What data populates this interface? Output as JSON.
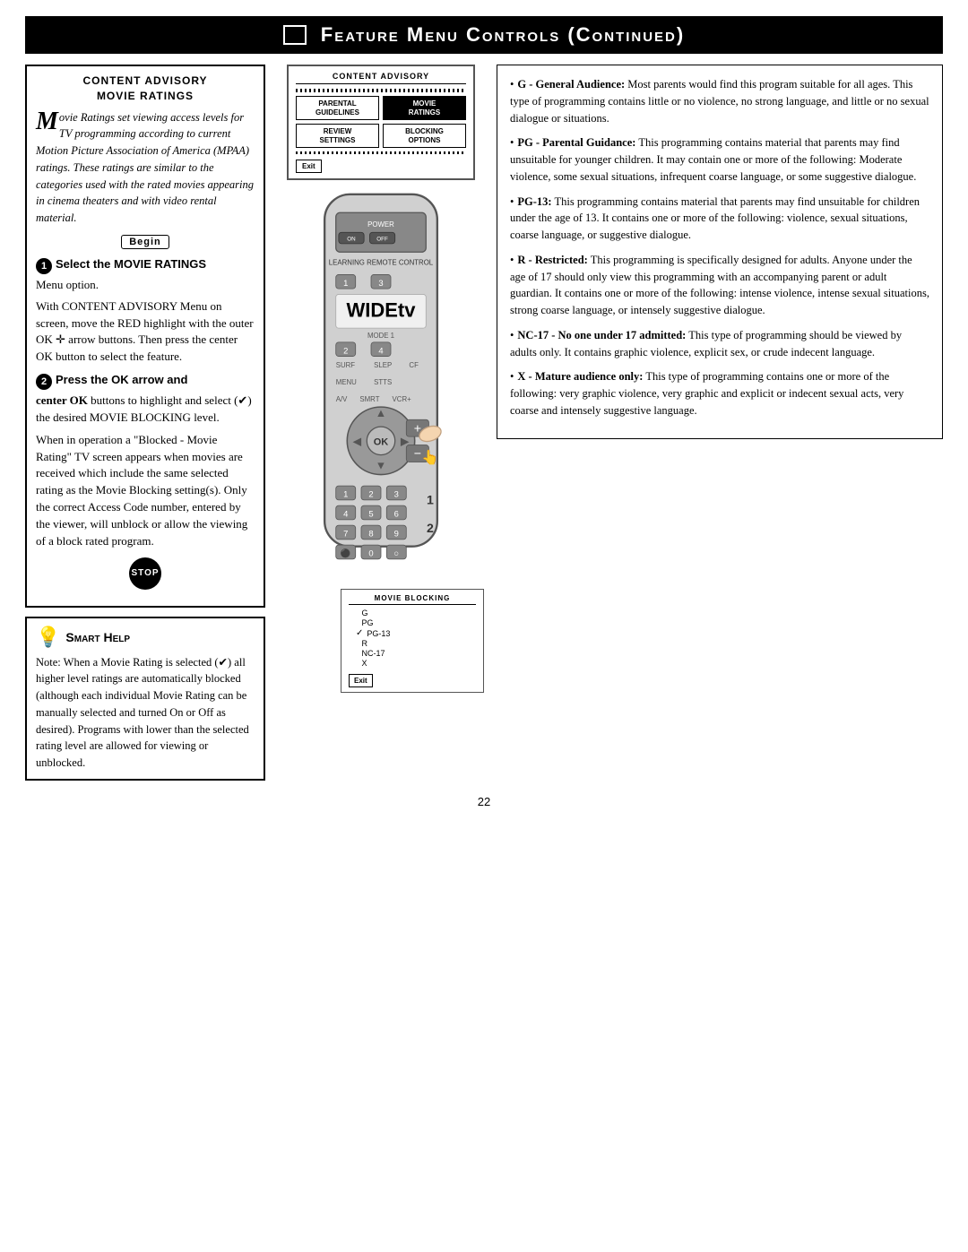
{
  "header": {
    "title": "Feature Menu Controls (Continued)",
    "corner_box": ""
  },
  "left_col": {
    "advisory_header_line1": "Content Advisory",
    "advisory_header_line2": "Movie Ratings",
    "drop_cap": "M",
    "advisory_body": "ovie Ratings set viewing access levels for TV programming according to current Motion Picture Association of America (MPAA) ratings. These ratings are similar to the categories used with the rated movies appearing in cinema theaters and with video rental material.",
    "begin_label": "Begin",
    "step1_title": "Select the MOVIE RATINGS",
    "step1_sub": "Menu option.",
    "step1_detail": "With CONTENT ADVISORY Menu on screen, move the RED highlight with the outer OK ✛ arrow buttons. Then press the center OK button to select the feature.",
    "step2_title": "Press the OK arrow and",
    "step2_detail_bold": "center OK",
    "step2_detail": " buttons to highlight and select (✔) the desired MOVIE BLOCKING level.",
    "step2_extra": "When in operation a \"Blocked - Movie Rating\" TV screen appears when movies are received which include the same selected rating as the Movie Blocking setting(s). Only the correct Access Code number, entered by the viewer, will unblock or allow the viewing of a block rated program.",
    "stop_label": "STOP",
    "smart_help_title": "Smart Help",
    "smart_help_body": "Note: When a Movie Rating is selected (✔) all higher level ratings are automatically blocked (although each individual Movie Rating can be manually selected and turned On or Off as desired). Programs with lower than the selected rating level are allowed for viewing or unblocked."
  },
  "middle": {
    "screen1": {
      "title": "Content Advisory",
      "btn1": "Parental\nGuidelines",
      "btn2": "Movie\nRatings",
      "btn3": "Review\nSettings",
      "btn4": "Blocking\nOptions",
      "exit": "Exit"
    },
    "screen2": {
      "title": "Movie Blocking",
      "items": [
        "G",
        "PG",
        "PG-13",
        "R",
        "NC-17",
        "X"
      ],
      "checked": "PG-13",
      "exit": "Exit"
    }
  },
  "right_col": {
    "bullets": [
      {
        "label": "G - General Audience:",
        "text": " Most parents would find this program suitable for all ages. This type of programming contains little or no violence, no strong language, and little or no sexual dialogue or situations."
      },
      {
        "label": "PG - Parental Guidance:",
        "text": " This programming contains material that parents may find unsuitable for younger children. It may contain one or more of the following: Moderate violence, some sexual situations, infrequent coarse language, or some suggestive dialogue."
      },
      {
        "label": "PG-13:",
        "text": " This programming contains material that parents may find unsuitable for children under the age of 13. It contains one or more of the following: violence, sexual situations, coarse language, or suggestive dialogue."
      },
      {
        "label": "R - Restricted:",
        "text": " This programming is specifically designed for adults. Anyone under the age of 17 should only view this programming with an accompanying parent or adult guardian. It contains one or more of the following: intense violence, intense sexual situations, strong coarse language, or intensely suggestive dialogue."
      },
      {
        "label": "NC-17 - No one under 17 admitted:",
        "text": " This type of programming should be viewed by adults only. It contains graphic violence, explicit sex, or crude indecent language."
      },
      {
        "label": "X - Mature audience only:",
        "text": " This type of programming contains one or more of the following: very graphic violence, very graphic and explicit or indecent sexual acts, very coarse and intensely suggestive language."
      }
    ]
  },
  "page_number": "22"
}
